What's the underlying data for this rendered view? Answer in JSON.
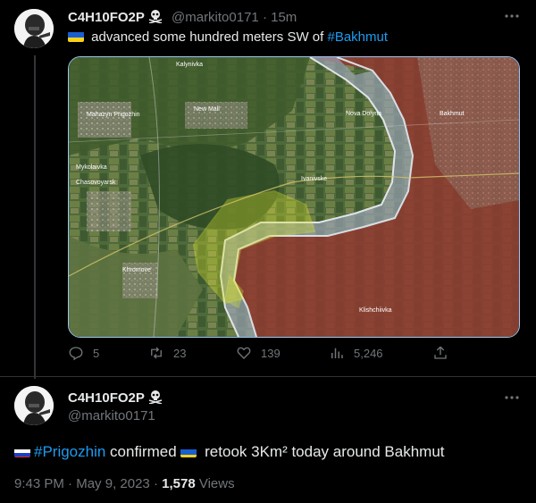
{
  "tweet1": {
    "display_name": "C4H10FO2P",
    "handle": "@markito0171",
    "sep": "·",
    "time": "15m",
    "text_pre": " advanced some hundred meters SW of ",
    "hashtag": "#Bakhmut",
    "flag_icon": "ukraine-flag-icon",
    "map_labels": {
      "place1": "Kalynivka",
      "place2": "Mahazyn Prigozhin",
      "place3": "Mykolaivka",
      "place4": "Chasovoyarsk",
      "place5": "New Mall",
      "place6": "Nova Dolyna",
      "place7": "Ivanivske",
      "place8": "Khromove",
      "place9": "Klishchiivka",
      "place10": "Bakhmut"
    },
    "actions": {
      "reply_count": "5",
      "retweet_count": "23",
      "like_count": "139",
      "views_count": "5,246"
    }
  },
  "tweet2": {
    "display_name": "C4H10FO2P",
    "handle": "@markito0171",
    "flag1_icon": "russia-flag-icon",
    "hashtag": "#Prigozhin",
    "text_mid": " confirmed ",
    "flag2_icon": "ukraine-flag-icon",
    "text_post": " retook 3Km² today around Bakhmut",
    "time": "9:43 PM",
    "sep": "·",
    "date": "May 9, 2023",
    "sep2": "·",
    "views": "1,578",
    "views_label": " Views"
  },
  "colors": {
    "accent": "#1d9bf0",
    "muted": "#71767b",
    "text": "#e7e9ea",
    "russian_zone": "#8e3a30",
    "ukraine_advance": "#d6e12a"
  }
}
